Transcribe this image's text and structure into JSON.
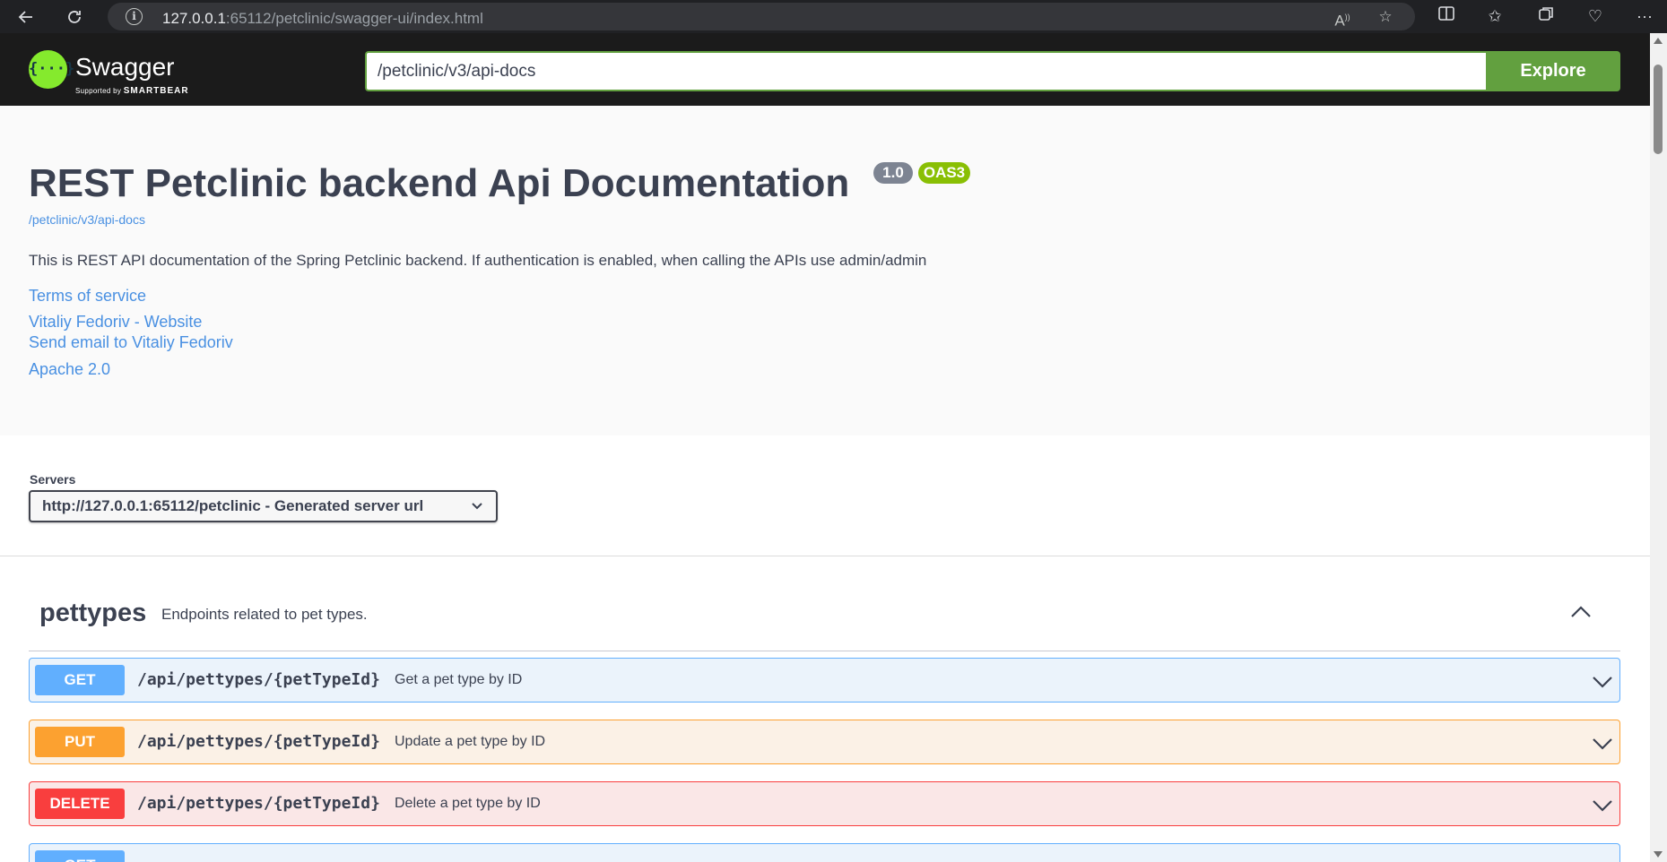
{
  "browser": {
    "url_host": "127.0.0.1",
    "url_rest": ":65112/petclinic/swagger-ui/index.html",
    "icons": [
      "back-icon",
      "refresh-icon",
      "site-info-icon",
      "read-aloud-icon",
      "favorite-star-icon",
      "split-screen-icon",
      "favorites-icon",
      "collections-icon",
      "health-icon",
      "more-icon"
    ]
  },
  "topbar": {
    "logo_text": "Swagger",
    "logo_symbol": "{···}",
    "logo_sub_prefix": "Supported by",
    "logo_sub_brand": "SMARTBEAR",
    "spec_url": "/petclinic/v3/api-docs",
    "explore_label": "Explore"
  },
  "info": {
    "title": "REST Petclinic backend Api Documentation",
    "version": "1.0",
    "oas_badge": "OAS3",
    "spec_link": "/petclinic/v3/api-docs",
    "description": "This is REST API documentation of the Spring Petclinic backend. If authentication is enabled, when calling the APIs use admin/admin",
    "terms_link": "Terms of service",
    "website_link": "Vitaliy Fedoriv - Website",
    "email_link": "Send email to Vitaliy Fedoriv",
    "license_link": "Apache 2.0"
  },
  "servers": {
    "label": "Servers",
    "selected": "http://127.0.0.1:65112/petclinic - Generated server url"
  },
  "tag": {
    "name": "pettypes",
    "description": "Endpoints related to pet types."
  },
  "operations": [
    {
      "method": "GET",
      "path": "/api/pettypes/{petTypeId}",
      "summary": "Get a pet type by ID"
    },
    {
      "method": "PUT",
      "path": "/api/pettypes/{petTypeId}",
      "summary": "Update a pet type by ID"
    },
    {
      "method": "DELETE",
      "path": "/api/pettypes/{petTypeId}",
      "summary": "Delete a pet type by ID"
    },
    {
      "method": "GET",
      "path": "",
      "summary": ""
    }
  ],
  "colors": {
    "get": "#61affe",
    "put": "#fca130",
    "delete": "#f93e3e",
    "swagger_green": "#62a03f",
    "link": "#4990e2"
  }
}
